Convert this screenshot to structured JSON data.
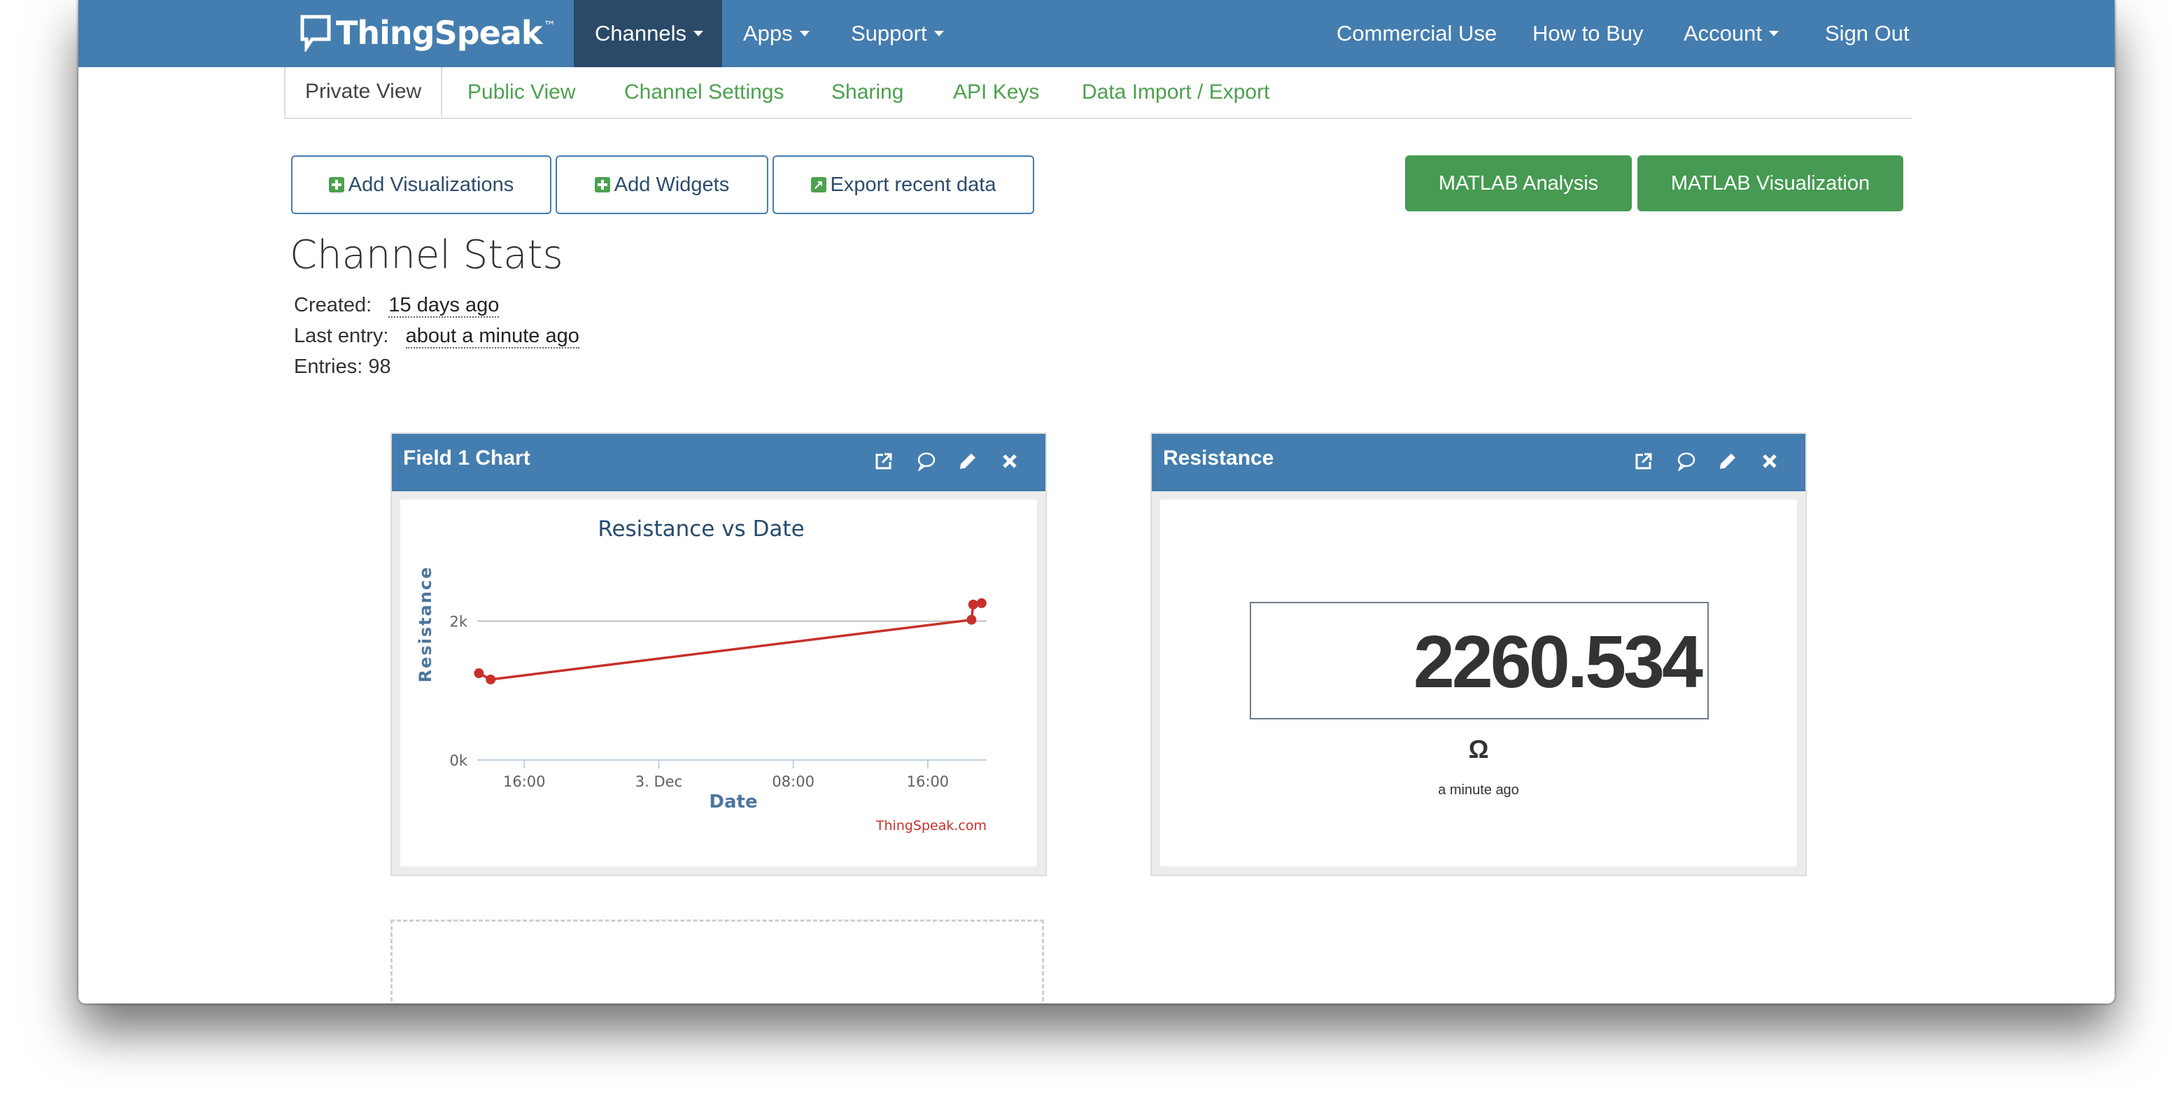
{
  "navbar": {
    "brand": "ThingSpeak",
    "trademark": "™",
    "left_items": [
      {
        "label": "Channels",
        "dropdown": true,
        "active": true
      },
      {
        "label": "Apps",
        "dropdown": true
      },
      {
        "label": "Support",
        "dropdown": true
      }
    ],
    "right_items": [
      {
        "label": "Commercial Use"
      },
      {
        "label": "How to Buy"
      },
      {
        "label": "Account",
        "dropdown": true
      },
      {
        "label": "Sign Out"
      }
    ]
  },
  "tabs": [
    {
      "label": "Private View",
      "active": true
    },
    {
      "label": "Public View"
    },
    {
      "label": "Channel Settings"
    },
    {
      "label": "Sharing"
    },
    {
      "label": "API Keys"
    },
    {
      "label": "Data Import / Export"
    }
  ],
  "actions": {
    "add_visualizations": "Add Visualizations",
    "add_widgets": "Add Widgets",
    "export_recent_data": "Export recent data",
    "matlab_analysis": "MATLAB Analysis",
    "matlab_visualization": "MATLAB Visualization"
  },
  "channel_stats": {
    "title": "Channel Stats",
    "created_label": "Created:",
    "created_value": "15 days ago",
    "last_entry_label": "Last entry:",
    "last_entry_value": "about a minute ago",
    "entries_label": "Entries: 98"
  },
  "chart_panel": {
    "title": "Field 1 Chart",
    "icons": [
      "external-link-icon",
      "comment-icon",
      "pencil-icon",
      "close-icon"
    ]
  },
  "chart_data": {
    "type": "line",
    "title": "Resistance vs Date",
    "xlabel": "Date",
    "ylabel": "Resistance",
    "credit": "ThingSpeak.com",
    "x_ticks": [
      "16:00",
      "3. Dec",
      "08:00",
      "16:00"
    ],
    "y_ticks": [
      "0k",
      "2k"
    ],
    "ylim": [
      0,
      2400
    ],
    "x_range_hours": [
      -2.8,
      27.5
    ],
    "x_tick_hours": [
      0,
      8,
      16,
      24
    ],
    "grid": true,
    "series": [
      {
        "name": "Resistance",
        "color": "#c8302b",
        "points": [
          {
            "x_hours": -2.7,
            "y": 1250
          },
          {
            "x_hours": -2.0,
            "y": 1160
          },
          {
            "x_hours": 26.6,
            "y": 2020
          },
          {
            "x_hours": 26.7,
            "y": 2240
          },
          {
            "x_hours": 27.2,
            "y": 2260
          }
        ]
      }
    ]
  },
  "resistance_panel": {
    "title": "Resistance",
    "value": "2260.534",
    "unit": "Ω",
    "updated": "a minute ago",
    "icons": [
      "external-link-icon",
      "comment-icon",
      "pencil-icon",
      "close-icon"
    ]
  },
  "colors": {
    "navbar": "#447daf",
    "navbar_active": "#2a4a68",
    "green": "#479a52",
    "tab_link": "#4ca14e",
    "series": "#c8302b"
  }
}
